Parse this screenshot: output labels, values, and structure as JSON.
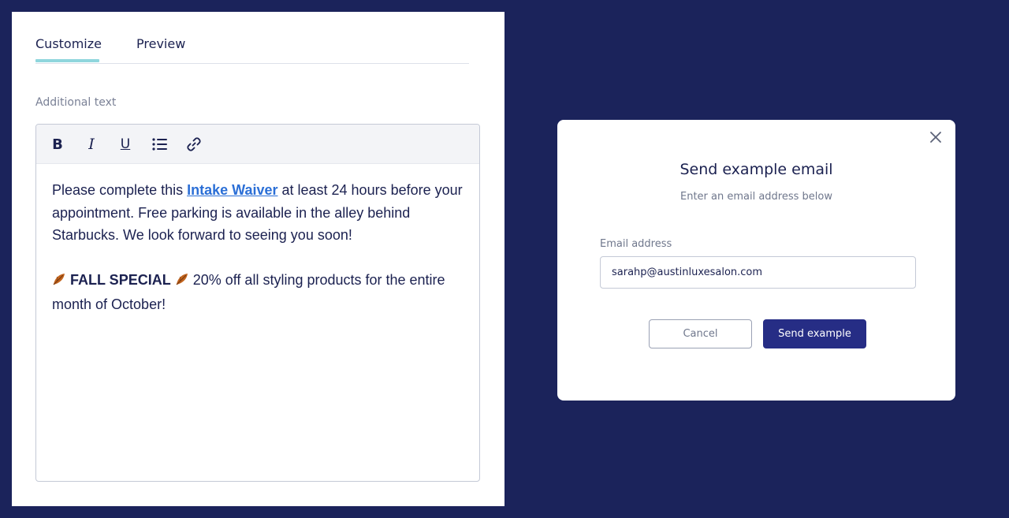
{
  "tabs": [
    {
      "label": "Customize",
      "active": true
    },
    {
      "label": "Preview",
      "active": false
    }
  ],
  "editor": {
    "label": "Additional text",
    "toolbar": {
      "bold": "B",
      "italic": "I",
      "underline": "U",
      "list_icon": "bulleted-list-icon",
      "link_icon": "link-icon"
    },
    "paragraph1": {
      "before": "Please complete this ",
      "link": "Intake Waiver",
      "after": " at least 24 hours before your appointment. Free parking is available in the alley behind Starbucks. We look forward to seeing you soon!"
    },
    "paragraph2": {
      "emoji": "fallen-leaf-icon",
      "bold": "FALL SPECIAL",
      "after": " 20% off all styling products for the entire month of October!"
    }
  },
  "modal": {
    "title": "Send example email",
    "subtitle": "Enter an email address below",
    "email_label": "Email address",
    "email_value": "sarahp@austinluxesalon.com",
    "cancel_label": "Cancel",
    "send_label": "Send example"
  },
  "colors": {
    "background": "#1b235b",
    "accent": "#262d85",
    "tab_underline": "#8fd6dd",
    "link": "#2b6fd6"
  }
}
